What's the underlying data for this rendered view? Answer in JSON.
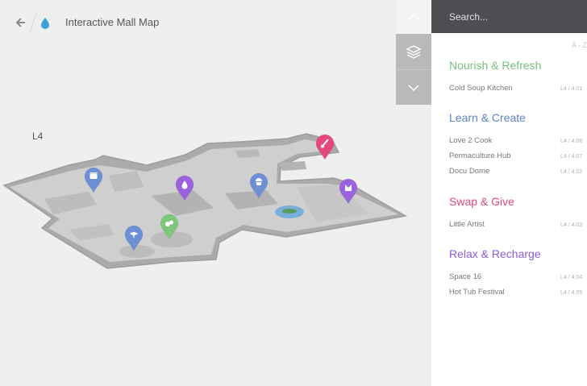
{
  "header": {
    "title": "Interactive Mall Map",
    "back_icon": "arrow-left-icon",
    "logo_icon": "water-drop-icon"
  },
  "controls": {
    "up_icon": "chevron-up-icon",
    "layers_icon": "layers-icon",
    "down_icon": "chevron-down-icon"
  },
  "map": {
    "level": "L4",
    "pins": [
      {
        "name": "cold-soup-kitchen-pin",
        "color": "#7dc67b",
        "icon": "fruit-icon"
      },
      {
        "name": "love-2-cook-pin",
        "color": "#6d8fd3",
        "icon": "cupcake-icon"
      },
      {
        "name": "permaculture-hub-pin",
        "color": "#6d8fd3",
        "icon": "plant-icon"
      },
      {
        "name": "docu-dome-pin",
        "color": "#6d8fd3",
        "icon": "film-icon"
      },
      {
        "name": "little-artist-pin",
        "color": "#e5487a",
        "icon": "brush-icon"
      },
      {
        "name": "space-16-pin",
        "color": "#9a63dd",
        "icon": "drop-icon"
      },
      {
        "name": "hot-tub-festival-pin",
        "color": "#9a63dd",
        "icon": "flower-icon"
      }
    ]
  },
  "sidebar": {
    "search_placeholder": "Search...",
    "sort_label": "A - Z",
    "categories": [
      {
        "title": "Nourish & Refresh",
        "color": "#77c27a",
        "items": [
          {
            "name": "Cold Soup Kitchen",
            "location": "L4 / 4.01"
          }
        ]
      },
      {
        "title": "Learn & Create",
        "color": "#5d82c6",
        "items": [
          {
            "name": "Love 2 Cook",
            "location": "L4 / 4.06"
          },
          {
            "name": "Permaculture Hub",
            "location": "L4 / 4.07"
          },
          {
            "name": "Docu Dome",
            "location": "L4 / 4.02"
          }
        ]
      },
      {
        "title": "Swap & Give",
        "color": "#e0497a",
        "items": [
          {
            "name": "Little Artist",
            "location": "L4 / 4.03"
          }
        ]
      },
      {
        "title": "Relax & Recharge",
        "color": "#8f5bd6",
        "items": [
          {
            "name": "Space 16",
            "location": "L4 / 4.04"
          },
          {
            "name": "Hot Tub Festival",
            "location": "L4 / 4.05"
          }
        ]
      }
    ]
  }
}
